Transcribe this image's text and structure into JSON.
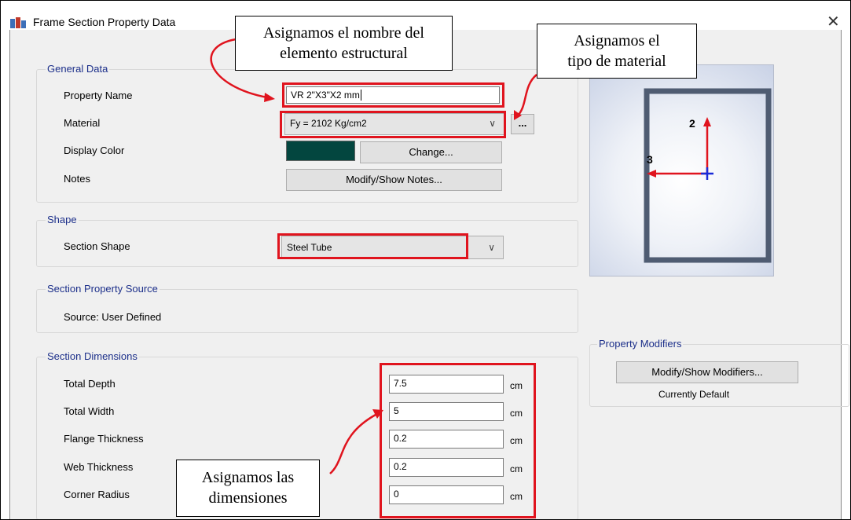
{
  "window": {
    "title": "Frame Section Property Data",
    "close_glyph": "✕"
  },
  "general": {
    "title": "General Data",
    "property_name_label": "Property Name",
    "property_name_value": "VR 2\"X3\"X2 mm",
    "material_label": "Material",
    "material_value": "Fy = 2102 Kg/cm2",
    "material_more": "...",
    "display_color_label": "Display Color",
    "display_color": "#03463f",
    "change_button": "Change...",
    "notes_label": "Notes",
    "notes_button": "Modify/Show Notes..."
  },
  "shape": {
    "title": "Shape",
    "section_shape_label": "Section Shape",
    "section_shape_value": "Steel Tube"
  },
  "source": {
    "title": "Section Property Source",
    "text": "Source:  User Defined"
  },
  "dimensions": {
    "title": "Section Dimensions",
    "rows": [
      {
        "label": "Total Depth",
        "value": "7.5",
        "unit": "cm"
      },
      {
        "label": "Total Width",
        "value": "5",
        "unit": "cm"
      },
      {
        "label": "Flange Thickness",
        "value": "0.2",
        "unit": "cm"
      },
      {
        "label": "Web Thickness",
        "value": "0.2",
        "unit": "cm"
      },
      {
        "label": "Corner Radius",
        "value": "0",
        "unit": "cm"
      }
    ]
  },
  "preview": {
    "axis2": "2",
    "axis3": "3"
  },
  "modifiers": {
    "title": "Property Modifiers",
    "button": "Modify/Show Modifiers...",
    "status": "Currently Default"
  },
  "annotations": {
    "name": [
      "Asignamos el nombre del",
      "elemento estructural"
    ],
    "material": [
      "Asignamos el",
      "tipo de material"
    ],
    "dims": [
      "Asignamos las",
      "dimensiones"
    ]
  },
  "colors": {
    "highlight": "#e0141e",
    "group_title": "#1c2f8a"
  }
}
